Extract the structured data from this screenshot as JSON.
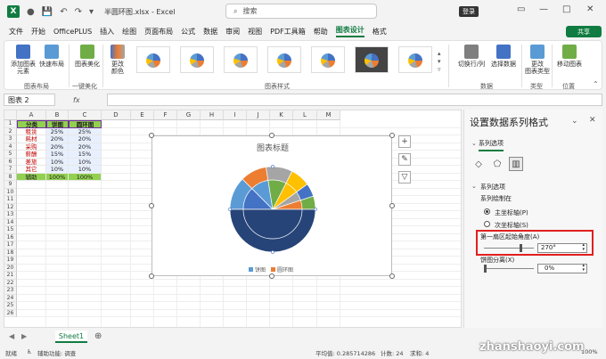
{
  "window": {
    "title": "半圆环图.xlsx - Excel",
    "search_placeholder": "搜索",
    "login": "登录"
  },
  "menu": [
    "文件",
    "开始",
    "OfficePLUS",
    "插入",
    "绘图",
    "页面布局",
    "公式",
    "数据",
    "审阅",
    "视图",
    "PDF工具箱",
    "帮助",
    "图表设计",
    "格式"
  ],
  "menu_active_index": 12,
  "share": "共享",
  "ribbon": {
    "add_element": "添加图表\n元素",
    "quick_layout": "快速布局",
    "beautify": "图表美化",
    "change_colors": "更改\n颜色",
    "switch_rowcol": "切换行/列",
    "select_data": "选择数据",
    "change_type": "更改\n图表类型",
    "move_chart": "移动图表",
    "groups": [
      "图表布局",
      "一键美化",
      "图表样式",
      "数据",
      "类型",
      "位置"
    ]
  },
  "formula": {
    "namebox": "图表 2",
    "fx": "fx",
    "value": ""
  },
  "sheet": {
    "columns": [
      "A",
      "B",
      "C",
      "D",
      "E",
      "F",
      "G",
      "H",
      "I",
      "J",
      "K",
      "L",
      "M"
    ],
    "rows": [
      "1",
      "2",
      "3",
      "4",
      "5",
      "6",
      "7",
      "8",
      "9",
      "10",
      "11",
      "12",
      "13",
      "14",
      "15",
      "16",
      "17",
      "18",
      "19",
      "20",
      "21",
      "22",
      "23",
      "24",
      "25",
      "26"
    ],
    "headers": [
      "分类",
      "饼图",
      "圆环图"
    ],
    "data": [
      [
        "租赁",
        "25%",
        "25%"
      ],
      [
        "耗材",
        "20%",
        "20%"
      ],
      [
        "采购",
        "20%",
        "20%"
      ],
      [
        "薪酬",
        "15%",
        "15%"
      ],
      [
        "差旅",
        "10%",
        "10%"
      ],
      [
        "其它",
        "10%",
        "10%"
      ],
      [
        "辅助",
        "100%",
        "100%"
      ]
    ]
  },
  "chart": {
    "title": "图表标题",
    "legend": [
      "饼图",
      "圆环图"
    ],
    "colors": {
      "pie": "#4472c4",
      "ring": [
        "#5b9bd5",
        "#ed7d31",
        "#a5a5a5",
        "#ffc000",
        "#4472c4",
        "#70ad47"
      ],
      "aux": "#264478"
    }
  },
  "chart_data": {
    "type": "pie",
    "title": "图表标题",
    "categories": [
      "租赁",
      "耗材",
      "采购",
      "薪酬",
      "差旅",
      "其它",
      "辅助"
    ],
    "series": [
      {
        "name": "饼图",
        "values": [
          25,
          20,
          20,
          15,
          10,
          10,
          100
        ]
      },
      {
        "name": "圆环图",
        "values": [
          25,
          20,
          20,
          15,
          10,
          10,
          100
        ]
      }
    ],
    "first_slice_angle": 270
  },
  "pane": {
    "title": "设置数据系列格式",
    "tab": "系列选项",
    "section": "系列选项",
    "plot_on": "系列绘制在",
    "primary": "主坐标轴(P)",
    "secondary": "次坐标轴(S)",
    "angle_label": "第一扇区起始角度(A)",
    "angle_value": "270°",
    "explosion_label": "饼图分离(X)",
    "explosion_value": "0%"
  },
  "sheet_tab": "Sheet1",
  "status": {
    "ready": "就绪",
    "accessibility": "辅助功能: 调查",
    "average": "平均值: 0.285714286",
    "count": "计数: 24",
    "sum": "求和: 4",
    "zoom": "100%"
  },
  "watermark": "zhanshaoyi.com"
}
